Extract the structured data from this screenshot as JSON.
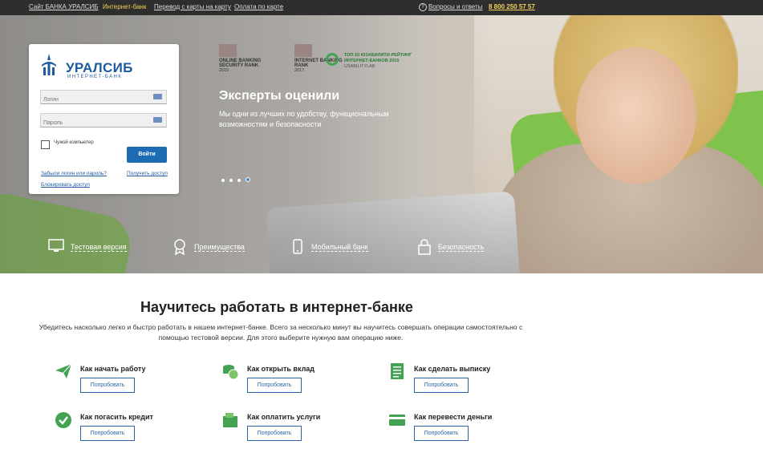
{
  "topbar": {
    "links": [
      "Сайт БАНКА УРАЛСИБ",
      "Интернет-банк",
      "Перевод с карты на карту",
      "Оплата по карте"
    ],
    "help": "Вопросы и ответы",
    "phone": "8 800 250 57 57"
  },
  "login": {
    "logo": "УРАЛСИБ",
    "logo_sub": "ИНТЕРНЕТ-БАНК",
    "login_placeholder": "Логин",
    "password_placeholder": "Пароль",
    "foreign_pc": "Чужой компьютер",
    "submit": "Войти",
    "forgot": "Забыли логин или пароль?",
    "get_access": "Получить доступ",
    "block": "Блокировать доступ"
  },
  "hero": {
    "rank1": {
      "title": "ONLINE BANKING SECURITY RANK",
      "year": "2015"
    },
    "rank2": {
      "title": "INTERNET BANKING RANK",
      "year": "2017"
    },
    "rank3": "ТОП 10 ЮЗАБИЛИТИ-РЕЙТИНГ ИНТЕРНЕТ-БАНКОВ 2015",
    "rank3_sub": "USABILITYLAB",
    "title": "Эксперты оценили",
    "subtitle": "Мы одни из лучших по удобству, функциональным возможностям и безопасности",
    "links": [
      "Тестовая версия",
      "Преимущества",
      "Мобильный банк",
      "Безопасность"
    ]
  },
  "learn": {
    "title": "Научитесь работать в интернет-банке",
    "intro": "Убедитесь насколько легко и быстро работать в нашем интернет-банке. Всего за несколько минут вы научитесь совершать операции самостоятельно с помощью тестовой версии. Для этого выберите нужную вам операцию ниже.",
    "items": [
      {
        "title": "Как начать работу",
        "button": "Попробовать",
        "icon": "paper-plane-icon"
      },
      {
        "title": "Как открыть вклад",
        "button": "Попробовать",
        "icon": "coins-icon"
      },
      {
        "title": "Как сделать выписку",
        "button": "Попробовать",
        "icon": "document-icon"
      },
      {
        "title": "Как погасить кредит",
        "button": "Попробовать",
        "icon": "checkmark-icon"
      },
      {
        "title": "Как оплатить услуги",
        "button": "Попробовать",
        "icon": "wallet-icon"
      },
      {
        "title": "Как перевести деньги",
        "button": "Попробовать",
        "icon": "card-icon"
      }
    ]
  },
  "colors": {
    "accent": "#1d6bb3",
    "green": "#43a352",
    "topbar_active": "#f0d25a"
  }
}
